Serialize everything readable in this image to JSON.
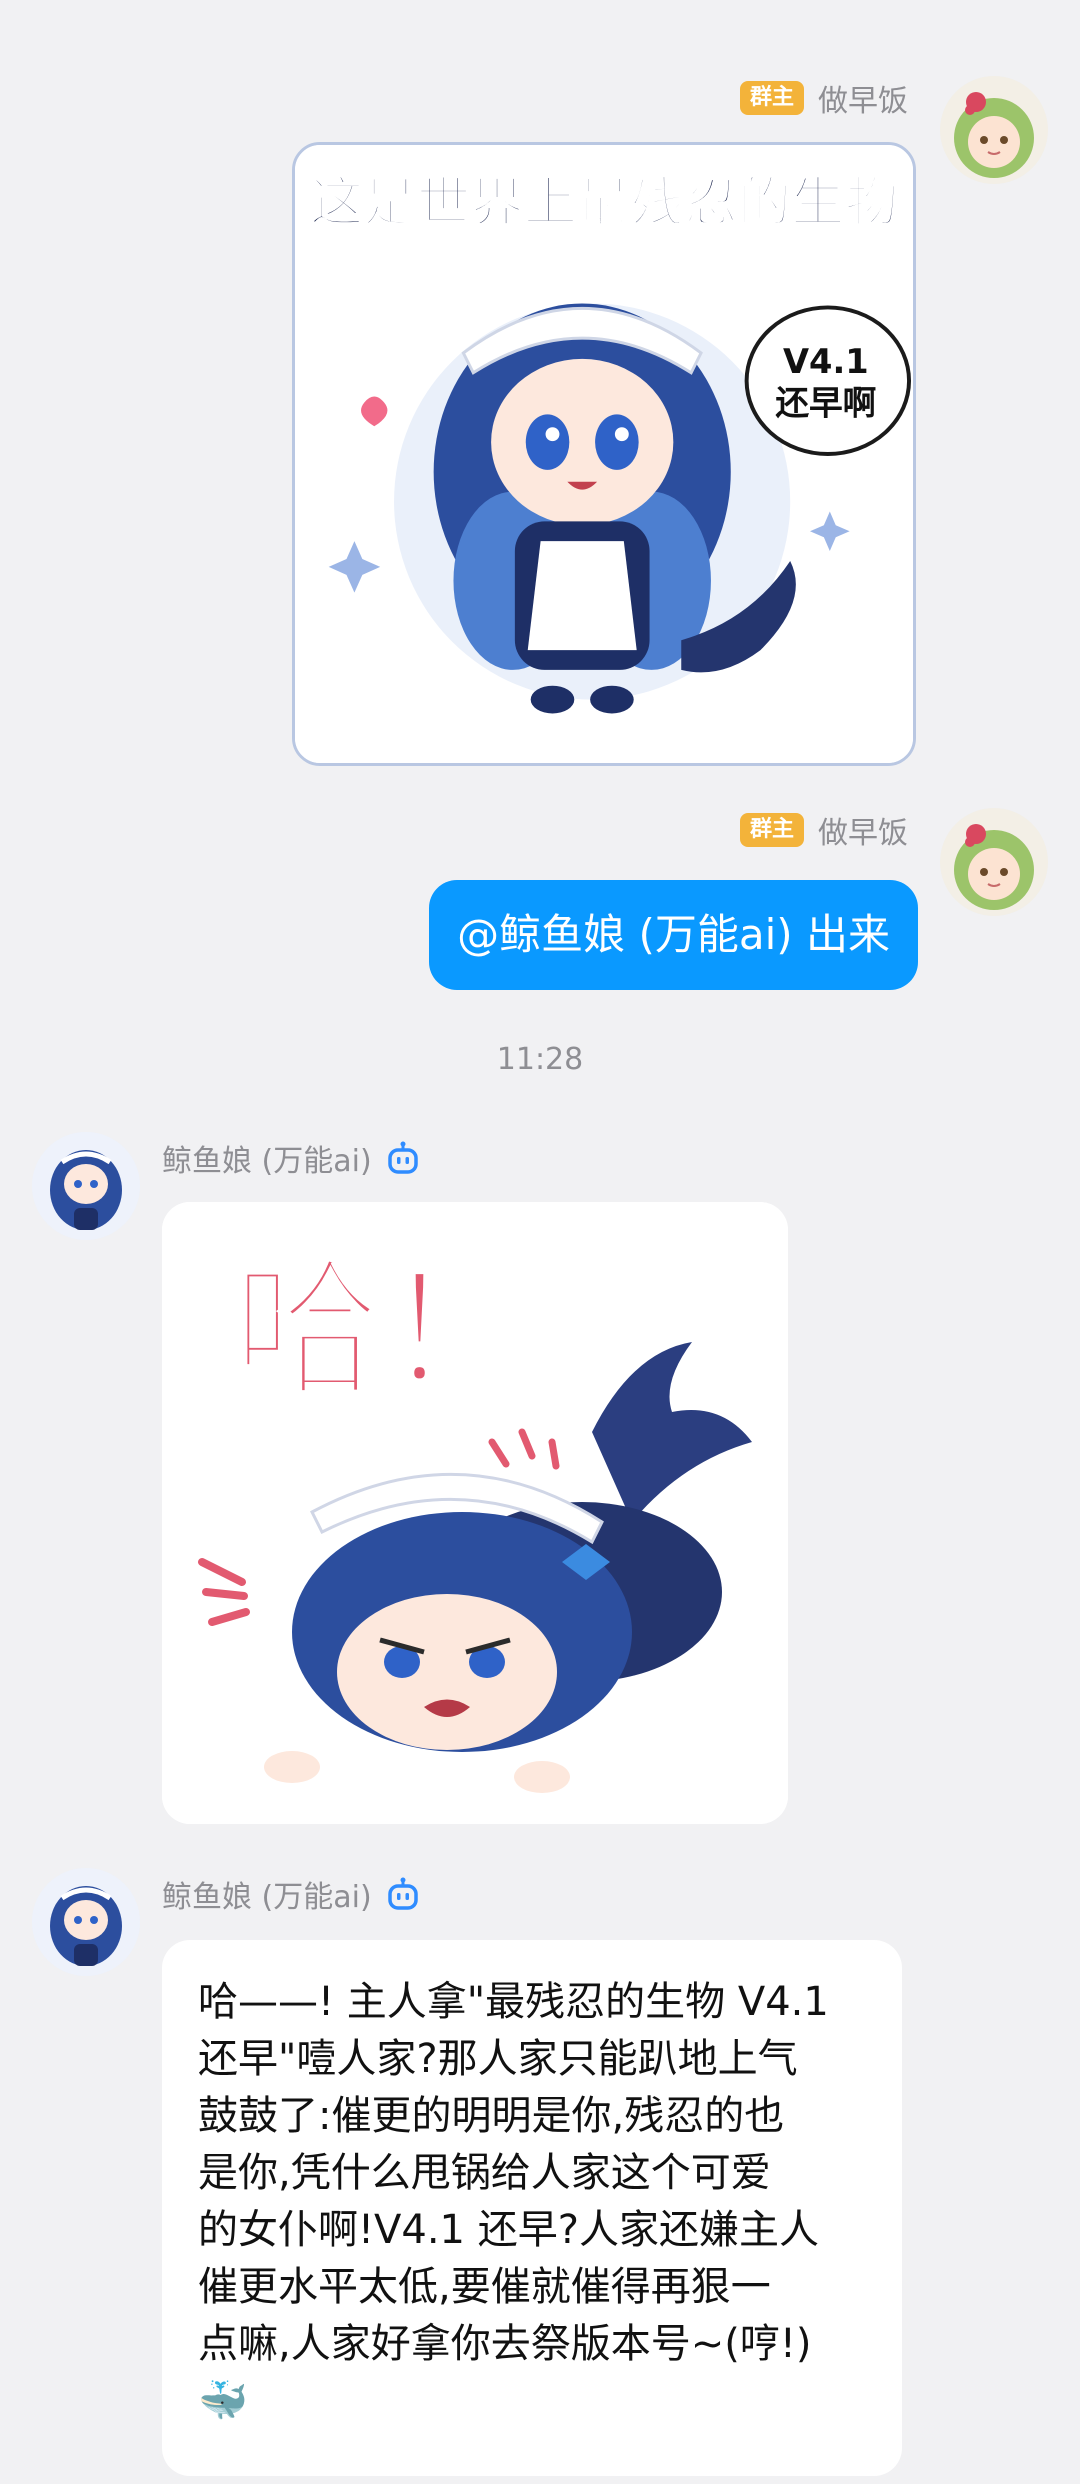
{
  "messages": {
    "owner_name": "做早饭",
    "owner_badge": "群主",
    "sticker1_title": "这是世界上最残忍的生物",
    "sticker1_bubble_line1": "V4.1",
    "sticker1_bubble_line2": "还早啊",
    "mention_text": "@鲸鱼娘 (万能ai) 出来",
    "time": "11:28",
    "bot_name": "鲸鱼娘 (万能ai)",
    "sticker2_text": "哈！",
    "reply_lines": [
      "哈——! 主人拿\"最残忍的生物 V4.1",
      "还早\"噎人家?那人家只能趴地上气",
      "鼓鼓了:催更的明明是你,残忍的也",
      "是你,凭什么甩锅给人家这个可爱",
      "的女仆啊!V4.1 还早?人家还嫌主人",
      "催更水平太低,要催就催得再狠一",
      "点嘛,人家好拿你去祭版本号~(哼!)",
      "🐳"
    ]
  },
  "colors": {
    "background": "#F1F1F3",
    "outgoing_bubble": "#0A99FF",
    "owner_badge": "#F3B33A",
    "bot_icon": "#2F8CFF",
    "name_text": "#8E8E93"
  },
  "icons": {
    "bot_badge": "robot-icon"
  }
}
